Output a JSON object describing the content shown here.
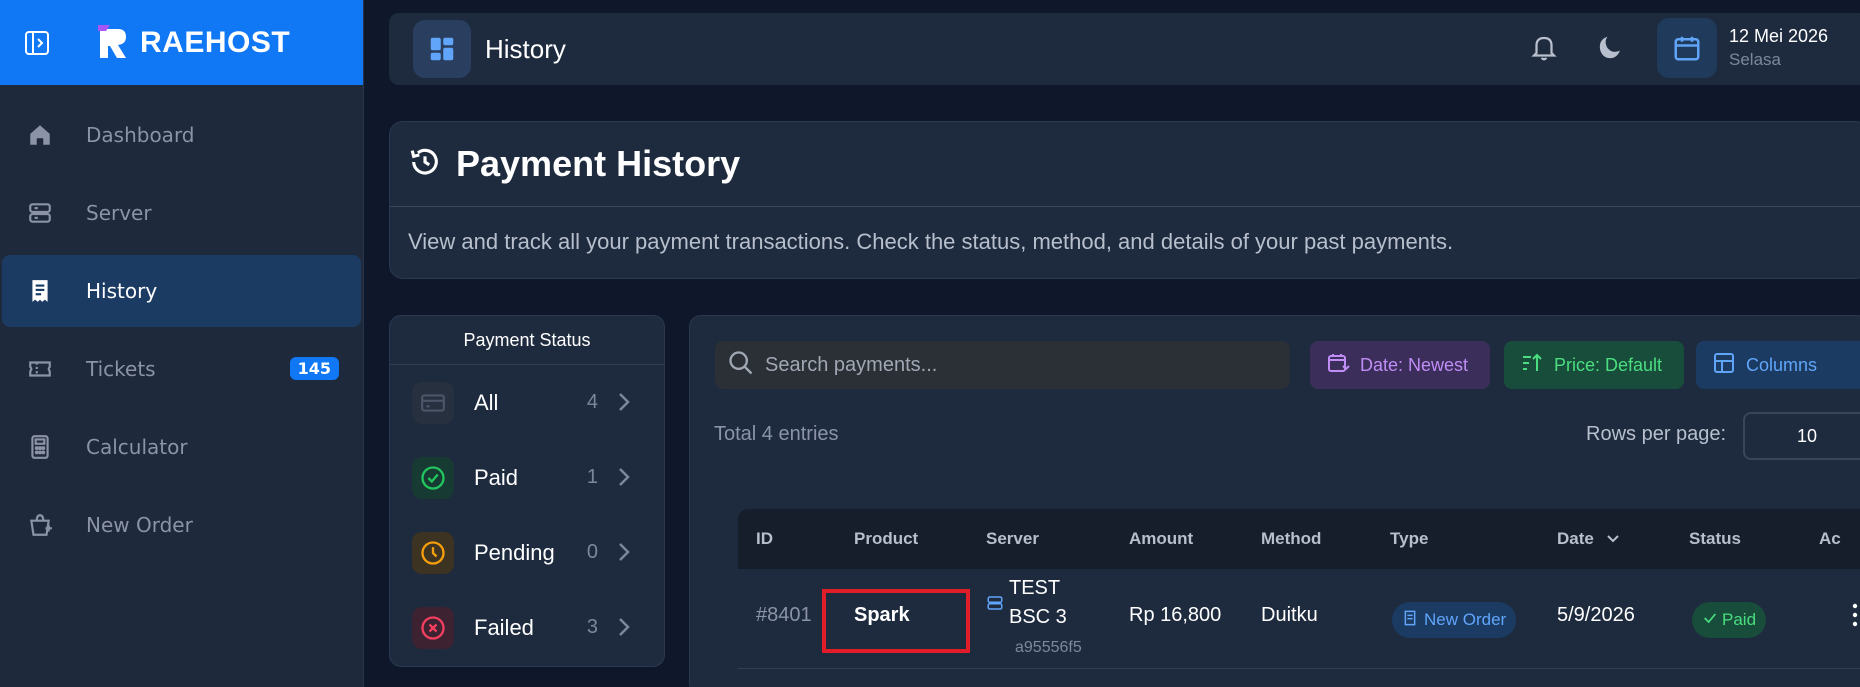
{
  "sidebar": {
    "brand": "RAEHOST",
    "items": [
      {
        "label": "Dashboard",
        "icon": "home-icon"
      },
      {
        "label": "Server",
        "icon": "server-icon"
      },
      {
        "label": "History",
        "icon": "receipt-icon",
        "active": true
      },
      {
        "label": "Tickets",
        "icon": "ticket-icon",
        "badge": "145"
      },
      {
        "label": "Calculator",
        "icon": "calculator-icon"
      },
      {
        "label": "New Order",
        "icon": "cart-plus-icon"
      }
    ]
  },
  "header": {
    "title": "History",
    "date": "12 Mei 2026",
    "day": "Selasa"
  },
  "payment_history": {
    "title": "Payment History",
    "description": "View and track all your payment transactions. Check the status, method, and details of your past payments."
  },
  "status_panel": {
    "title": "Payment Status",
    "items": [
      {
        "label": "All",
        "count": "4",
        "icon": "card-icon"
      },
      {
        "label": "Paid",
        "count": "1",
        "icon": "check-circle-icon"
      },
      {
        "label": "Pending",
        "count": "0",
        "icon": "clock-icon"
      },
      {
        "label": "Failed",
        "count": "3",
        "icon": "x-circle-icon"
      }
    ]
  },
  "toolbar": {
    "search_placeholder": "Search payments...",
    "date_sort": "Date: Newest",
    "price_sort": "Price: Default",
    "columns": "Columns"
  },
  "table": {
    "total": "Total 4 entries",
    "rows_per_page_label": "Rows per page:",
    "rows_per_page": "10",
    "columns": [
      "ID",
      "Product",
      "Server",
      "Amount",
      "Method",
      "Type",
      "Date",
      "Status",
      "Ac"
    ],
    "rows": [
      {
        "id": "#8401",
        "product": "Spark",
        "server_line1": "TEST",
        "server_line2": "BSC 3",
        "server_id": "a95556f5",
        "amount": "Rp 16,800",
        "method": "Duitku",
        "type": "New Order",
        "date": "5/9/2026",
        "status": "Paid"
      }
    ]
  },
  "colors": {
    "accent": "#1077f5",
    "paid": "#4ade80",
    "pending": "#f59e0b",
    "failed": "#f43f5e",
    "highlight": "#e11d2a"
  }
}
